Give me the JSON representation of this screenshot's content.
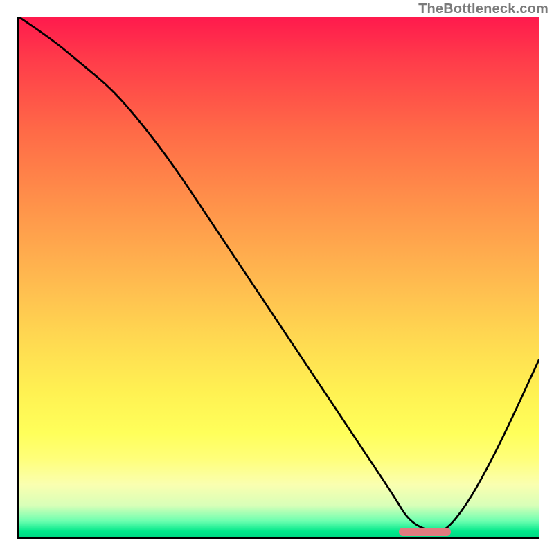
{
  "watermark": "TheBottleneck.com",
  "chart_data": {
    "type": "line",
    "title": "",
    "xlabel": "",
    "ylabel": "",
    "xlim": [
      0,
      100
    ],
    "ylim": [
      0,
      100
    ],
    "grid": false,
    "series": [
      {
        "name": "bottleneck-curve",
        "x": [
          0,
          6,
          12,
          18,
          24,
          30,
          36,
          42,
          48,
          54,
          60,
          66,
          72,
          75,
          79,
          82,
          86,
          90,
          94,
          100
        ],
        "y": [
          100,
          96,
          91,
          86,
          79,
          71,
          62,
          53,
          44,
          35,
          26,
          17,
          8,
          3,
          1,
          1,
          6,
          13,
          21,
          34
        ]
      }
    ],
    "annotations": [
      {
        "name": "optimal-range",
        "x_start": 73,
        "x_end": 83,
        "y": 1
      }
    ],
    "background_gradient": {
      "top": "#ff1a4d",
      "mid": "#ffe552",
      "bottom": "#00da84"
    }
  }
}
